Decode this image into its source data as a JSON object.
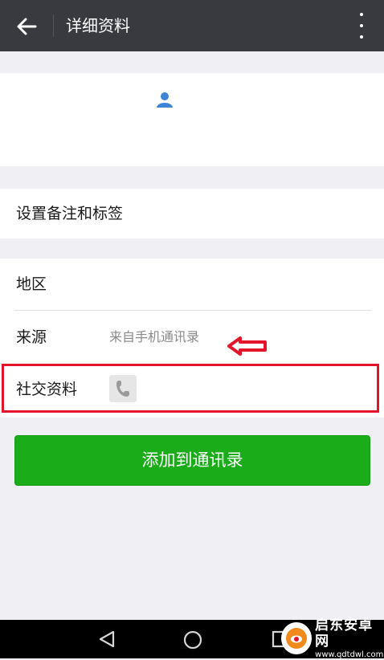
{
  "header": {
    "title": "详细资料"
  },
  "remark_row": {
    "label": "设置备注和标签"
  },
  "info_rows": {
    "region_label": "地区",
    "source_label": "来源",
    "source_value": "来自手机通讯录",
    "social_label": "社交资料"
  },
  "actions": {
    "add_button": "添加到通讯录"
  },
  "watermark": {
    "name": "启东安卓网",
    "url": "www.qdtdwl.com"
  },
  "colors": {
    "topbar": "#393a3f",
    "background": "#efeff4",
    "primary_button": "#1aad19",
    "annotation_red": "#e4142a"
  },
  "icons": {
    "back": "arrow-left-icon",
    "more": "more-vertical-icon",
    "contact": "contact-person-icon",
    "phone": "phone-icon",
    "annotation": "arrow-left-outline-icon",
    "nav_back": "triangle-back-icon",
    "nav_home": "circle-home-icon",
    "nav_recent": "square-recent-icon"
  }
}
